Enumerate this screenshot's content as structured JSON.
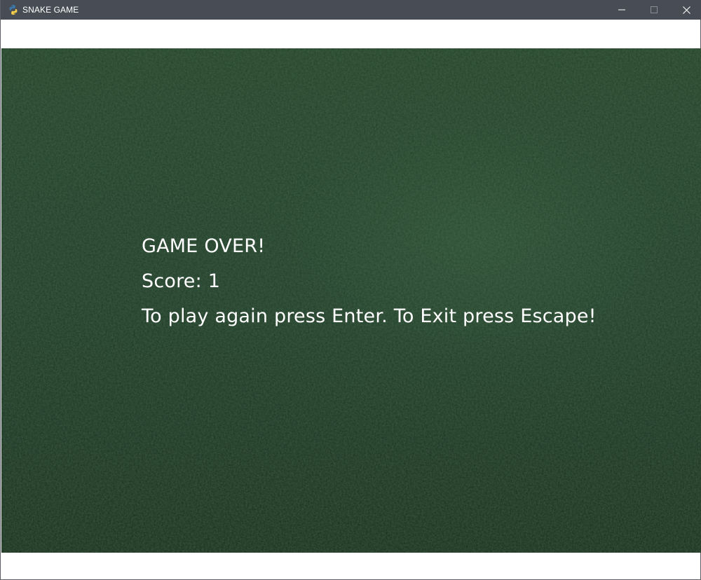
{
  "window": {
    "title": "SNAKE GAME",
    "app_icon": "python-icon",
    "controls": {
      "minimize_icon": "minimize-icon",
      "maximize_icon": "maximize-icon",
      "close_icon": "close-icon"
    }
  },
  "game": {
    "game_over_text": "GAME OVER!",
    "score_label": "Score: 1",
    "instructions": "To play again press Enter. To Exit press Escape!",
    "colors": {
      "background": "#173220",
      "text": "#ffffff",
      "titlebar": "#484d55"
    }
  }
}
